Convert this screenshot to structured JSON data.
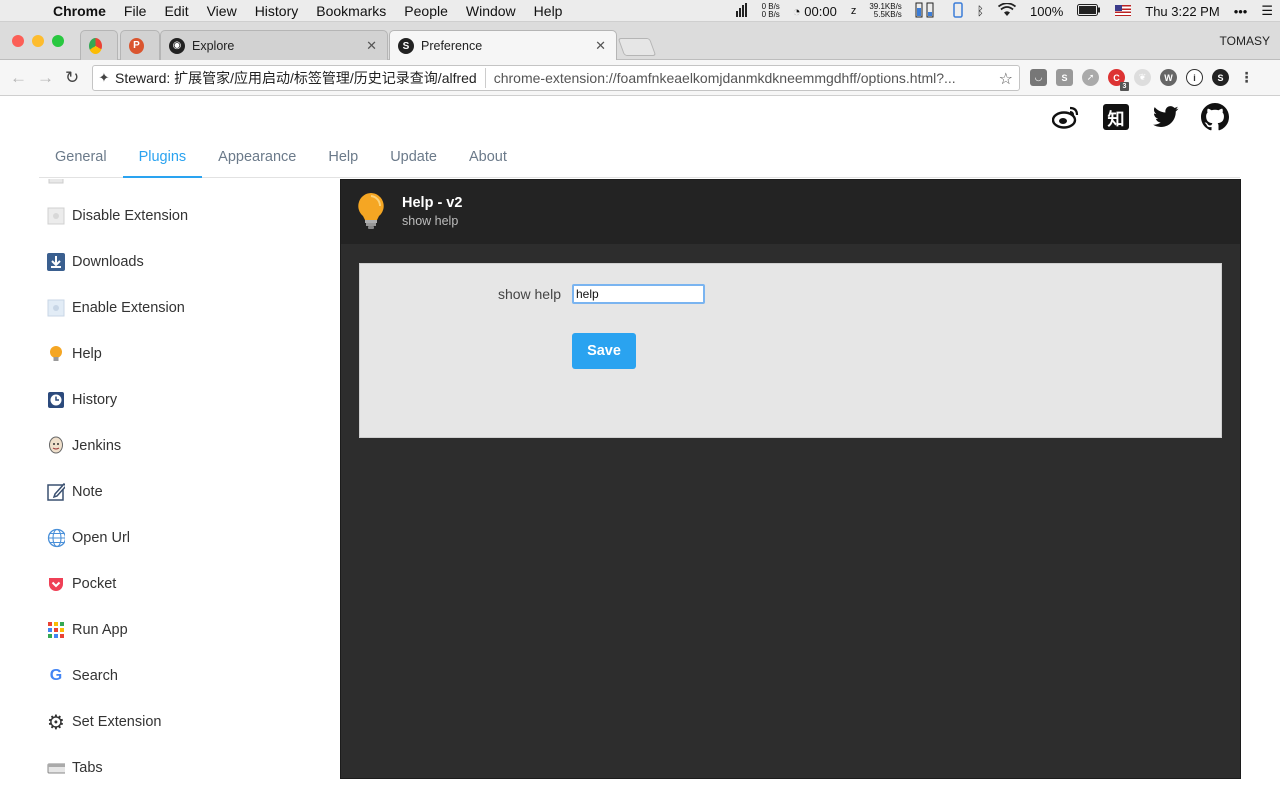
{
  "menubar": {
    "app": "Chrome",
    "items": [
      "File",
      "Edit",
      "View",
      "History",
      "Bookmarks",
      "People",
      "Window",
      "Help"
    ],
    "net_up": "0 B/s",
    "net_down": "0 B/s",
    "timer": "00:00",
    "speed_up": "39.1KB/s",
    "speed_down": "5.5KB/s",
    "battery": "100%",
    "clock": "Thu 3:22 PM"
  },
  "tabs": [
    {
      "title": ""
    },
    {
      "title": ""
    },
    {
      "title": "Explore"
    },
    {
      "title": "Preference"
    }
  ],
  "profile": "TOMASY",
  "omnibox": {
    "title": "Steward: 扩展管家/应用启动/标签管理/历史记录查询/alfred",
    "url": "chrome-extension://foamfnkeaelkomjdanmkdkneemmgdhff/options.html?..."
  },
  "ext_badge": "3",
  "nav": {
    "tabs": [
      "General",
      "Plugins",
      "Appearance",
      "Help",
      "Update",
      "About"
    ],
    "active": "Plugins"
  },
  "sidebar": {
    "items": [
      {
        "label": "Disable Extension",
        "icon": "puzzle-icon"
      },
      {
        "label": "Downloads",
        "icon": "download-icon"
      },
      {
        "label": "Enable Extension",
        "icon": "puzzle-icon"
      },
      {
        "label": "Help",
        "icon": "bulb-icon"
      },
      {
        "label": "History",
        "icon": "clock-icon"
      },
      {
        "label": "Jenkins",
        "icon": "jenkins-icon"
      },
      {
        "label": "Note",
        "icon": "note-icon"
      },
      {
        "label": "Open Url",
        "icon": "globe-icon"
      },
      {
        "label": "Pocket",
        "icon": "pocket-icon"
      },
      {
        "label": "Run App",
        "icon": "apps-grid-icon"
      },
      {
        "label": "Search",
        "icon": "google-icon"
      },
      {
        "label": "Set Extension",
        "icon": "gear-icon"
      },
      {
        "label": "Tabs",
        "icon": "tabs-icon"
      }
    ]
  },
  "plugin": {
    "name": "Help - v2",
    "desc": "show help",
    "field_label": "show help",
    "field_value": "help",
    "save_label": "Save"
  },
  "colors": {
    "accent": "#2aa3f0",
    "panel_dark": "#2d2d2d",
    "panel_header": "#232323"
  }
}
